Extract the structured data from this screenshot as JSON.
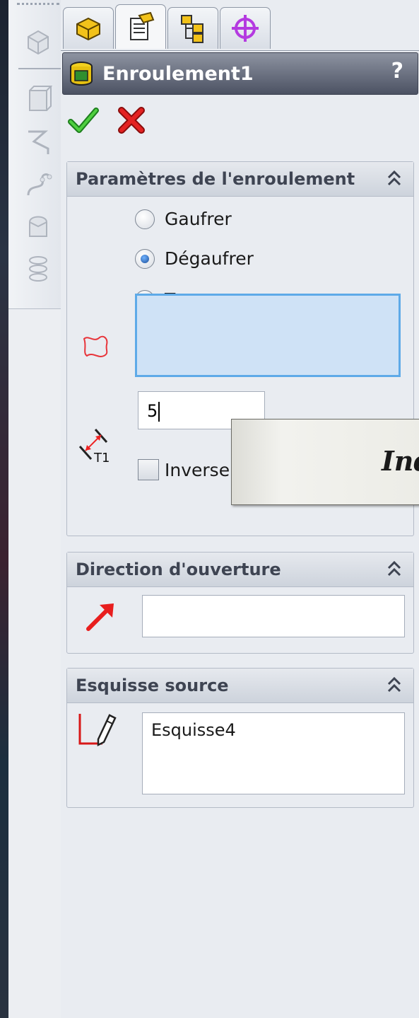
{
  "feature": {
    "title": "Enroulement1",
    "help_label": "?"
  },
  "tabs": [
    {
      "name": "FeatureManager",
      "icon": "feature-manager-icon"
    },
    {
      "name": "PropertyManager",
      "icon": "property-manager-icon",
      "active": true
    },
    {
      "name": "ConfigurationManager",
      "icon": "configuration-manager-icon"
    },
    {
      "name": "DimXpertManager",
      "icon": "dimxpert-icon"
    }
  ],
  "actions": {
    "ok_icon": "checkmark-icon",
    "cancel_icon": "red-x-icon"
  },
  "wrap_parameters": {
    "title": "Paramètres de l'enroulement",
    "options": [
      {
        "label": "Gaufrer",
        "checked": false
      },
      {
        "label": "Dégaufrer",
        "checked": true
      },
      {
        "label": "Tracer",
        "checked": false
      }
    ],
    "face_selection": "",
    "thickness_value": "5",
    "reverse_label": "Inverser la direction",
    "reverse_checked": false
  },
  "pull_direction": {
    "title": "Direction d'ouverture",
    "value": ""
  },
  "source_sketch": {
    "title": "Esquisse source",
    "items": [
      "Esquisse4"
    ]
  },
  "tooltip": {
    "text": "Ind"
  },
  "colors": {
    "header_bg": "#5e6474",
    "accent_blue": "#5eaae8",
    "selection_fill": "#cfe2f6"
  }
}
